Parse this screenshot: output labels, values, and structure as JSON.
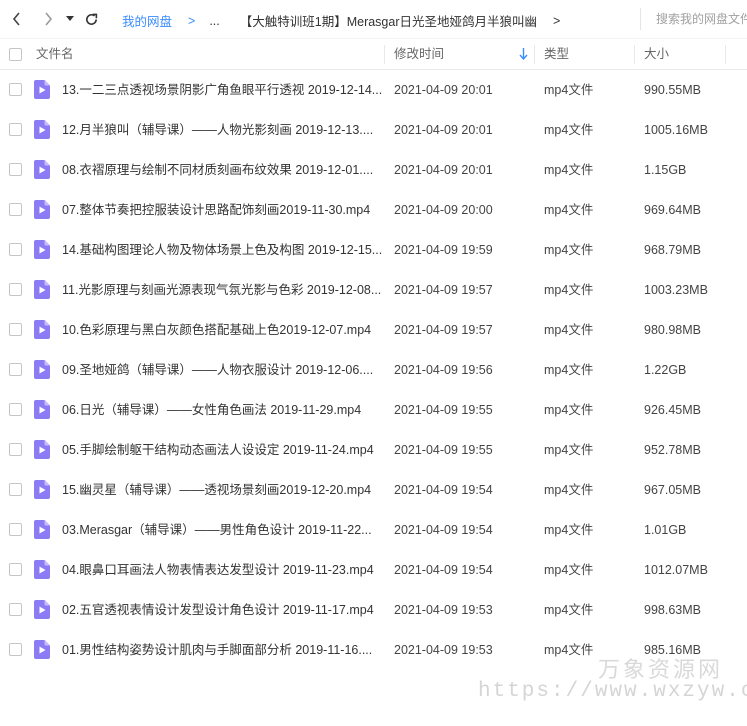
{
  "breadcrumb": {
    "root": "我的网盘",
    "separator": ">",
    "ellipsis": "...",
    "current": "【大触特训班1期】Merasgar日光圣地娅鸽月半狼叫幽",
    "end": ">"
  },
  "search": {
    "placeholder": "搜索我的网盘文件"
  },
  "columns": {
    "name": "文件名",
    "time": "修改时间",
    "type": "类型",
    "size": "大小"
  },
  "icons": {
    "file": "video-file-icon",
    "fileColor": "#8b7cf6",
    "accent": "#3b8cff"
  },
  "files": [
    {
      "name": "13.一二三点透视场景阴影广角鱼眼平行透视 2019-12-14...",
      "time": "2021-04-09 20:01",
      "type": "mp4文件",
      "size": "990.55MB"
    },
    {
      "name": "12.月半狼叫（辅导课）——人物光影刻画 2019-12-13....",
      "time": "2021-04-09 20:01",
      "type": "mp4文件",
      "size": "1005.16MB"
    },
    {
      "name": "08.衣褶原理与绘制不同材质刻画布纹效果 2019-12-01....",
      "time": "2021-04-09 20:01",
      "type": "mp4文件",
      "size": "1.15GB"
    },
    {
      "name": "07.整体节奏把控服装设计思路配饰刻画2019-11-30.mp4",
      "time": "2021-04-09 20:00",
      "type": "mp4文件",
      "size": "969.64MB"
    },
    {
      "name": "14.基础构图理论人物及物体场景上色及构图 2019-12-15...",
      "time": "2021-04-09 19:59",
      "type": "mp4文件",
      "size": "968.79MB"
    },
    {
      "name": "11.光影原理与刻画光源表现气氛光影与色彩 2019-12-08...",
      "time": "2021-04-09 19:57",
      "type": "mp4文件",
      "size": "1003.23MB"
    },
    {
      "name": "10.色彩原理与黑白灰颜色搭配基础上色2019-12-07.mp4",
      "time": "2021-04-09 19:57",
      "type": "mp4文件",
      "size": "980.98MB"
    },
    {
      "name": "09.圣地娅鸽（辅导课）——人物衣服设计 2019-12-06....",
      "time": "2021-04-09 19:56",
      "type": "mp4文件",
      "size": "1.22GB"
    },
    {
      "name": "06.日光（辅导课）——女性角色画法 2019-11-29.mp4",
      "time": "2021-04-09 19:55",
      "type": "mp4文件",
      "size": "926.45MB"
    },
    {
      "name": "05.手脚绘制躯干结构动态画法人设设定 2019-11-24.mp4",
      "time": "2021-04-09 19:55",
      "type": "mp4文件",
      "size": "952.78MB"
    },
    {
      "name": "15.幽灵星（辅导课）——透视场景刻画2019-12-20.mp4",
      "time": "2021-04-09 19:54",
      "type": "mp4文件",
      "size": "967.05MB"
    },
    {
      "name": "03.Merasgar（辅导课）——男性角色设计 2019-11-22...",
      "time": "2021-04-09 19:54",
      "type": "mp4文件",
      "size": "1.01GB"
    },
    {
      "name": "04.眼鼻口耳画法人物表情表达发型设计 2019-11-23.mp4",
      "time": "2021-04-09 19:54",
      "type": "mp4文件",
      "size": "1012.07MB"
    },
    {
      "name": "02.五官透视表情设计发型设计角色设计 2019-11-17.mp4",
      "time": "2021-04-09 19:53",
      "type": "mp4文件",
      "size": "998.63MB"
    },
    {
      "name": "01.男性结构姿势设计肌肉与手脚面部分析 2019-11-16....",
      "time": "2021-04-09 19:53",
      "type": "mp4文件",
      "size": "985.16MB"
    }
  ],
  "watermark": {
    "title": "万象资源网",
    "url": "https://www.wxzyw.cn"
  }
}
